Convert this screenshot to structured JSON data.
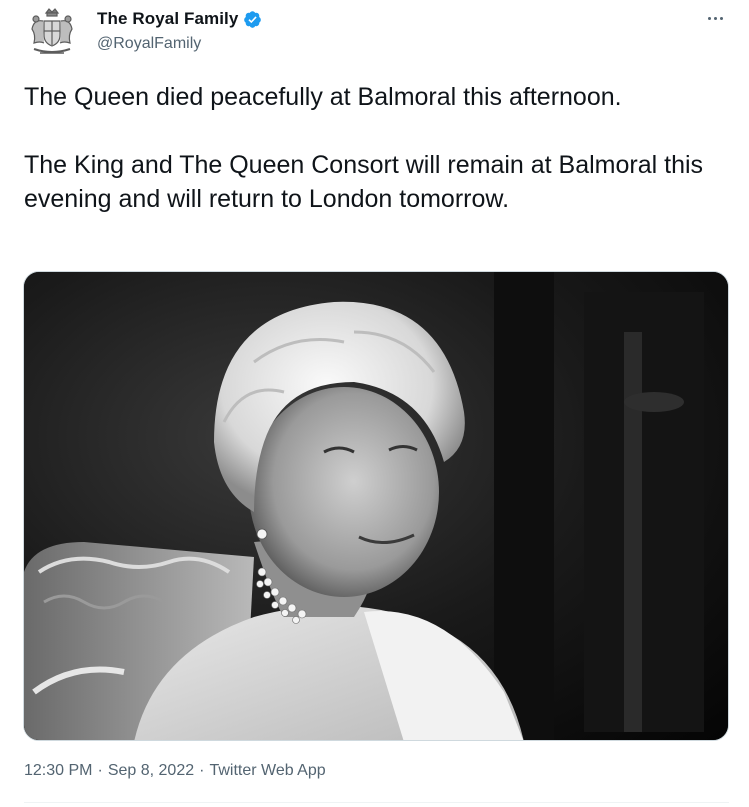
{
  "author": {
    "display_name": "The Royal Family",
    "handle": "@RoyalFamily",
    "avatar_icon": "royal-coat-of-arms",
    "verified_color": "#1d9bf0"
  },
  "tweet": {
    "paragraphs": [
      "The Queen died peacefully at Balmoral this afternoon.",
      "The King and The Queen Consort will remain at Balmoral this evening and will return to London tomorrow."
    ],
    "media_description": "black-and-white portrait photo"
  },
  "meta": {
    "time": "12:30 PM",
    "date": "Sep 8, 2022",
    "source": "Twitter Web App",
    "separator": "·"
  },
  "colors": {
    "text": "#0f1419",
    "secondary": "#536471",
    "border": "#cfd9de"
  }
}
